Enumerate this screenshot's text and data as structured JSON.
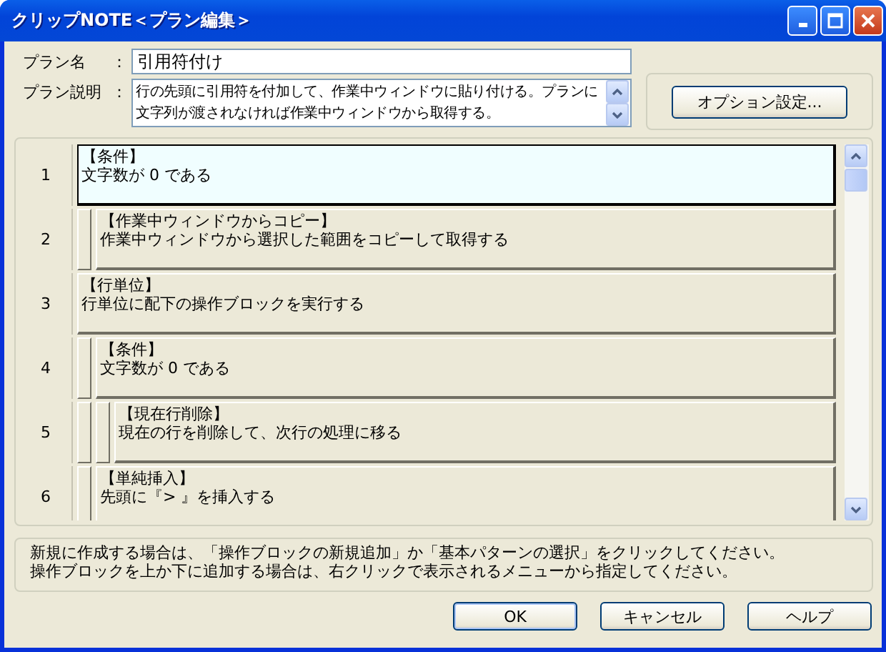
{
  "window": {
    "title": "クリップNOTE＜プラン編集＞"
  },
  "plan_name": {
    "label": "プラン名",
    "colon": "：",
    "value": "引用符付け"
  },
  "plan_description": {
    "label": "プラン説明",
    "colon": "：",
    "value": "行の先頭に引用符を付加して、作業中ウィンドウに貼り付ける。プランに文字列が渡されなければ作業中ウィンドウから取得する。"
  },
  "options_button": "オプション設定...",
  "blocks": [
    {
      "number": "1",
      "title": "【条件】",
      "text": "文字数が 0 である",
      "selected": true,
      "children": [
        {
          "number": "2",
          "title": "【作業中ウィンドウからコピー】",
          "text": "作業中ウィンドウから選択した範囲をコピーして取得する",
          "selected": false
        }
      ]
    },
    {
      "number": "3",
      "title": "【行単位】",
      "text": "行単位に配下の操作ブロックを実行する",
      "selected": false,
      "children": [
        {
          "number": "4",
          "title": "【条件】",
          "text": "文字数が 0 である",
          "selected": false,
          "children": [
            {
              "number": "5",
              "title": "【現在行削除】",
              "text": "現在の行を削除して、次行の処理に移る",
              "selected": false
            }
          ]
        },
        {
          "number": "6",
          "title": "【単純挿入】",
          "text": "先頭に『> 』を挿入する",
          "selected": false
        }
      ]
    }
  ],
  "hint": [
    "新規に作成する場合は、「操作ブロックの新規追加」か「基本パターンの選択」をクリックしてください。",
    "操作ブロックを上か下に追加する場合は、右クリックで表示されるメニューから指定してください。"
  ],
  "buttons": [
    "OK",
    "キャンセル",
    "ヘルプ"
  ]
}
